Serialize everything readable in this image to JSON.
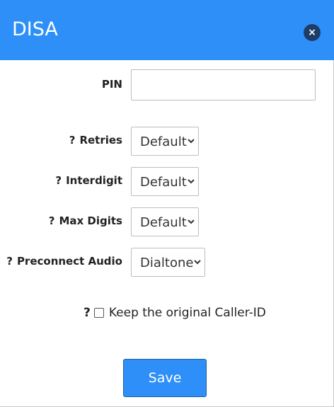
{
  "dialog": {
    "title": "DISA",
    "close_glyph": "×"
  },
  "form": {
    "pin": {
      "label": "PIN",
      "value": ""
    },
    "retries": {
      "help": "?",
      "label": "Retries",
      "value": "Default"
    },
    "interdigit": {
      "help": "?",
      "label": "Interdigit",
      "value": "Default"
    },
    "max_digits": {
      "help": "?",
      "label": "Max Digits",
      "value": "Default"
    },
    "preconnect_audio": {
      "help": "?",
      "label": "Preconnect Audio",
      "value": "Dialtone"
    },
    "keep_caller_id": {
      "help": "?",
      "label": "Keep the original Caller-ID",
      "checked": false
    }
  },
  "actions": {
    "save_label": "Save"
  },
  "colors": {
    "header": "#2d8ff7",
    "close_button": "#1e3d66",
    "save_button": "#2d8ff7"
  },
  "icons": {
    "close": "close-icon",
    "select_arrow": "chevron-down-icon"
  }
}
